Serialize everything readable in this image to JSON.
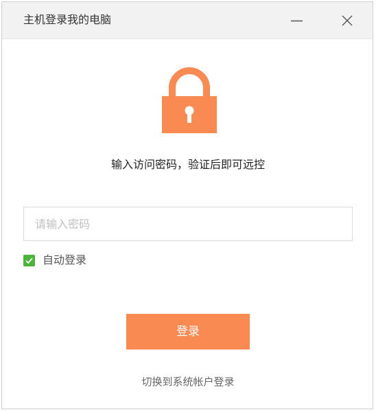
{
  "window": {
    "title": "主机登录我的电脑"
  },
  "titlebar_buttons": {
    "minimize_icon": "minimize-icon",
    "close_icon": "close-icon"
  },
  "lock_icon": "lock-icon",
  "colors": {
    "accent": "#f98a52",
    "lock": "#f98a52",
    "checkbox": "#4cb43b"
  },
  "prompt": "输入访问密码，验证后即可远控",
  "password": {
    "value": "",
    "placeholder": "请输入密码"
  },
  "auto_login": {
    "label": "自动登录",
    "checked": true
  },
  "login_button": {
    "label": "登录"
  },
  "switch_link": {
    "label": "切换到系统帐户登录"
  }
}
